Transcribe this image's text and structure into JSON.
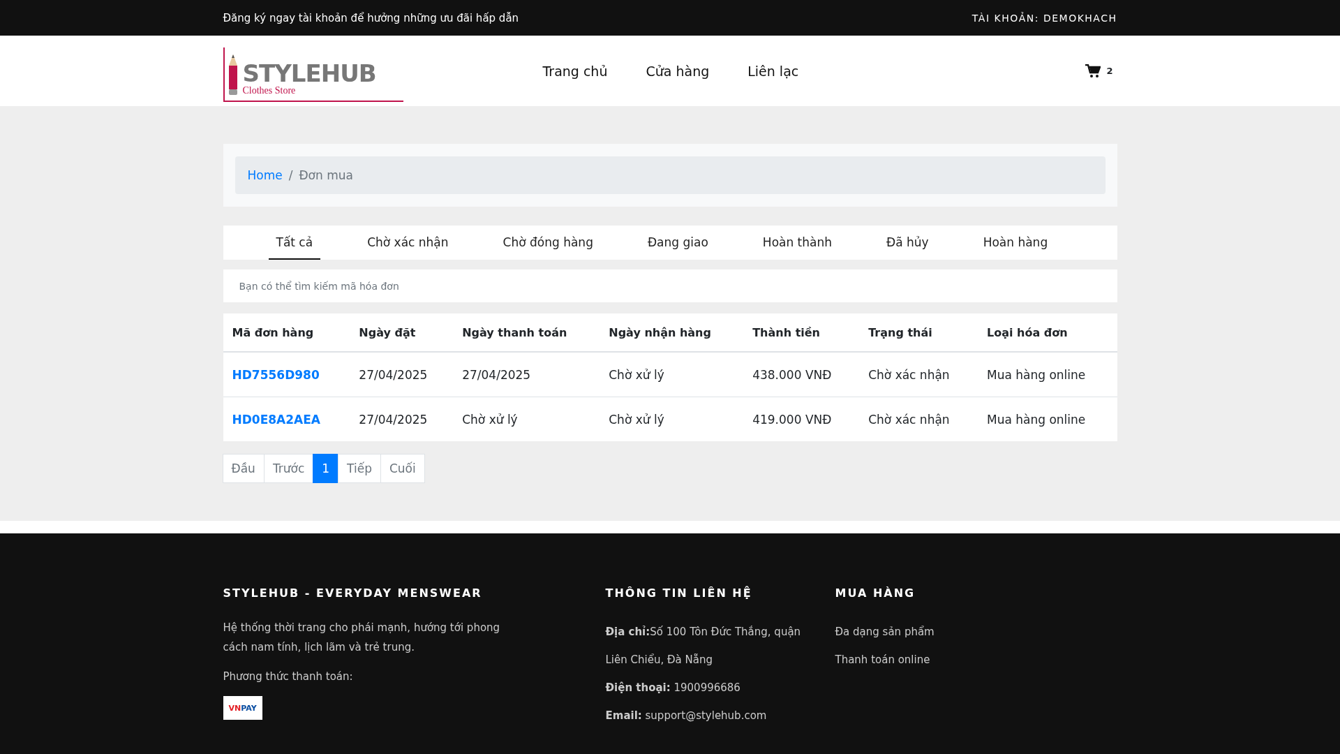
{
  "top_bar": {
    "promo": "Đăng ký ngay tài khoản để hưởng những ưu đãi hấp dẫn",
    "account": "TÀI KHOẢN: DEMOKHACH"
  },
  "header": {
    "logo": {
      "name": "STYLEHUB",
      "tagline": "Clothes Store"
    },
    "nav": [
      "Trang chủ",
      "Cửa hàng",
      "Liên lạc"
    ],
    "cart_count": "2"
  },
  "breadcrumb": {
    "separator": "/",
    "items": [
      "Home",
      "Đơn mua"
    ]
  },
  "tabs": [
    {
      "label": "Tất cả",
      "selected": true
    },
    {
      "label": "Chờ xác nhận",
      "selected": false
    },
    {
      "label": "Chờ đóng hàng",
      "selected": false
    },
    {
      "label": "Đang giao",
      "selected": false
    },
    {
      "label": "Hoàn thành",
      "selected": false
    },
    {
      "label": "Đã hủy",
      "selected": false
    },
    {
      "label": "Hoàn hàng",
      "selected": false
    }
  ],
  "search": {
    "placeholder": "Bạn có thể tìm kiếm mã hóa đơn"
  },
  "table": {
    "columns": [
      "Mã đơn hàng",
      "Ngày đặt",
      "Ngày thanh toán",
      "Ngày nhận hàng",
      "Thành tiền",
      "Trạng thái",
      "Loại hóa đơn"
    ],
    "rows": [
      [
        "HD7556D980",
        "27/04/2025",
        "27/04/2025",
        "Chờ xử lý",
        "438.000 VNĐ",
        "Chờ xác nhận",
        "Mua hàng online"
      ],
      [
        "HD0E8A2AEA",
        "27/04/2025",
        "Chờ xử lý",
        "Chờ xử lý",
        "419.000 VNĐ",
        "Chờ xác nhận",
        "Mua hàng online"
      ]
    ]
  },
  "pagination": [
    {
      "label": "Đầu",
      "selected": false
    },
    {
      "label": "Trước",
      "selected": false
    },
    {
      "label": "1",
      "selected": true
    },
    {
      "label": "Tiếp",
      "selected": false
    },
    {
      "label": "Cuối",
      "selected": false
    }
  ],
  "footer": {
    "about": {
      "title": "STYLEHUB - EVERYDAY MENSWEAR",
      "text": "Hệ thống thời trang cho phái mạnh, hướng tới phong cách nam tính, lịch lãm và trẻ trung.",
      "payment_label": "Phương thức thanh toán:",
      "payment_logo": [
        "VN",
        "PAY"
      ]
    },
    "contact": {
      "title": "THÔNG TIN LIÊN HỆ",
      "lines": [
        "**Địa chỉ:**Số 100 Tôn Đức Thắng, quận Liên Chiểu, Đà Nẵng",
        "**Điện thoại:** 1900996686",
        "**Email:** support@stylehub.com"
      ]
    },
    "shop": {
      "title": "MUA HÀNG",
      "links": [
        "Đa dạng sản phẩm",
        "Thanh toán online"
      ]
    }
  }
}
